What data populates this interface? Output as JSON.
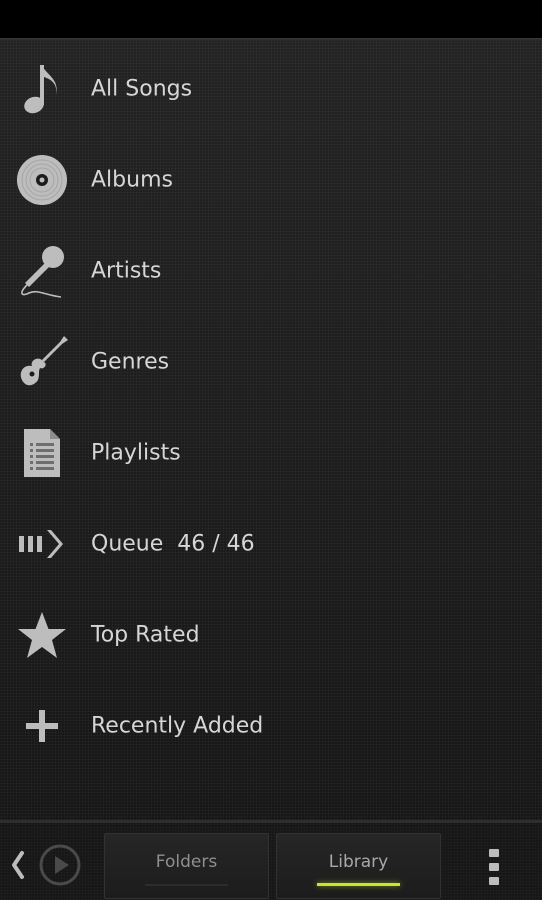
{
  "menu": {
    "items": [
      {
        "icon": "music-note-icon",
        "label": "All Songs"
      },
      {
        "icon": "vinyl-record-icon",
        "label": "Albums"
      },
      {
        "icon": "microphone-icon",
        "label": "Artists"
      },
      {
        "icon": "guitar-icon",
        "label": "Genres"
      },
      {
        "icon": "document-list-icon",
        "label": "Playlists"
      },
      {
        "icon": "queue-arrow-icon",
        "label": "Queue  46 / 46"
      },
      {
        "icon": "star-icon",
        "label": "Top Rated"
      },
      {
        "icon": "plus-icon",
        "label": "Recently Added"
      }
    ]
  },
  "bottom_bar": {
    "tabs": [
      {
        "label": "Folders",
        "active": false
      },
      {
        "label": "Library",
        "active": true
      }
    ]
  },
  "colors": {
    "accent": "#c8e62a",
    "text": "#d6d6d6",
    "icon": "#bdbdbd",
    "background": "#1c1c1c"
  }
}
